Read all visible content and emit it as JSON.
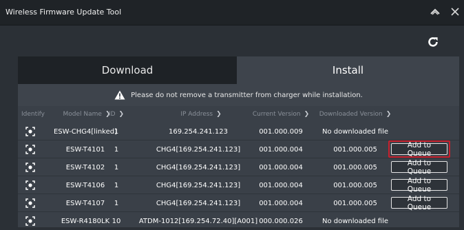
{
  "window": {
    "title": "Wireless Firmware Update Tool"
  },
  "tabs": [
    {
      "label": "Download",
      "active": false
    },
    {
      "label": "Install",
      "active": true
    }
  ],
  "warning": {
    "text": "Please do not remove a transmitter from charger while installation."
  },
  "columns": {
    "identify": "Identify",
    "model": "Model Name",
    "id": "ID",
    "ip": "IP Address",
    "current": "Current Version",
    "downloaded": "Downloaded Version"
  },
  "rows": [
    {
      "model": "ESW-CHG4[linked]",
      "id": "1",
      "ip": "169.254.241.123",
      "current": "001.000.009",
      "downloaded": "No downloaded file",
      "action": ""
    },
    {
      "model": "ESW-T4101",
      "id": "1",
      "ip": "CHG4[169.254.241.123]",
      "current": "001.000.004",
      "downloaded": "001.000.005",
      "action": "Add to Queue"
    },
    {
      "model": "ESW-T4102",
      "id": "1",
      "ip": "CHG4[169.254.241.123]",
      "current": "001.000.004",
      "downloaded": "001.000.005",
      "action": "Add to Queue"
    },
    {
      "model": "ESW-T4106",
      "id": "1",
      "ip": "CHG4[169.254.241.123]",
      "current": "001.000.004",
      "downloaded": "001.000.005",
      "action": "Add to Queue"
    },
    {
      "model": "ESW-T4107",
      "id": "1",
      "ip": "CHG4[169.254.241.123]",
      "current": "001.000.004",
      "downloaded": "001.000.005",
      "action": "Add to Queue"
    },
    {
      "model": "ESW-R4180LK",
      "id": "10",
      "ip": "ATDM-1012[169.254.72.40][A001]",
      "current": "000.000.026",
      "downloaded": "No downloaded file",
      "action": ""
    }
  ],
  "colors": {
    "highlight": "#c8202d",
    "warning_icon": "#ffffff",
    "active_tab": "#3e444c"
  },
  "icons": {
    "collapse": "chevron-up-icon",
    "close": "close-icon",
    "refresh": "refresh-icon",
    "warning": "warning-icon",
    "identify": "identify-target-icon"
  }
}
